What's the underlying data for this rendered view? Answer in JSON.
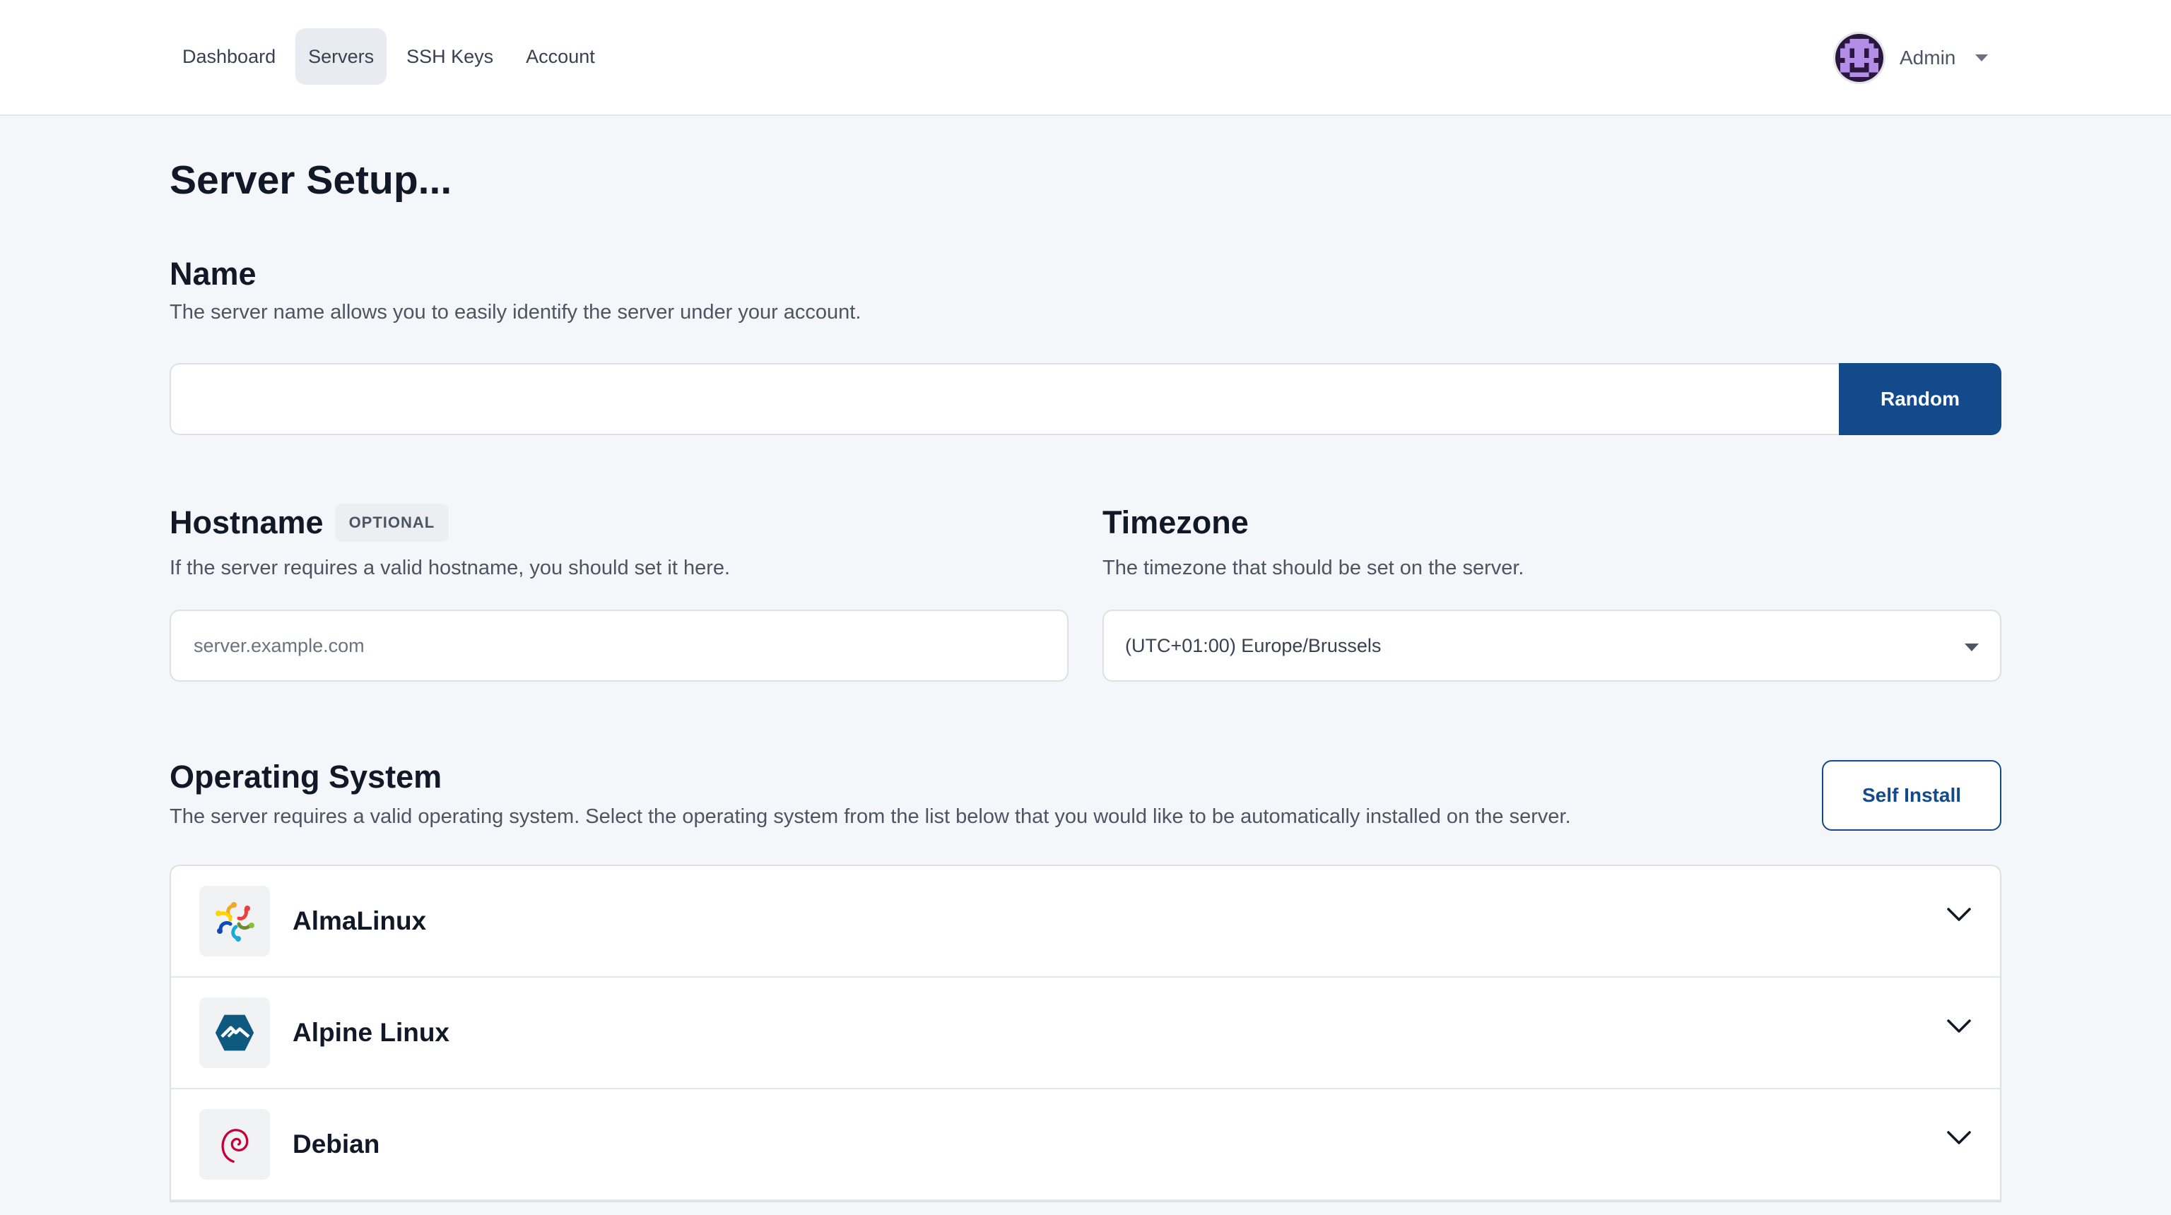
{
  "nav": {
    "items": [
      {
        "label": "Dashboard",
        "active": false
      },
      {
        "label": "Servers",
        "active": true
      },
      {
        "label": "SSH Keys",
        "active": false
      },
      {
        "label": "Account",
        "active": false
      }
    ],
    "user": {
      "name": "Admin",
      "avatar_icon": "pixel-avatar-icon"
    }
  },
  "page": {
    "title": "Server Setup..."
  },
  "name_section": {
    "title": "Name",
    "description": "The server name allows you to easily identify the server under your account.",
    "value": "",
    "random_label": "Random"
  },
  "hostname_section": {
    "title": "Hostname",
    "badge": "OPTIONAL",
    "description": "If the server requires a valid hostname, you should set it here.",
    "value": "",
    "placeholder": "server.example.com"
  },
  "timezone_section": {
    "title": "Timezone",
    "description": "The timezone that should be set on the server.",
    "selected": "(UTC+01:00) Europe/Brussels"
  },
  "os_section": {
    "title": "Operating System",
    "description": "The server requires a valid operating system. Select the operating system from the list below that you would like to be automatically installed on the server.",
    "self_install_label": "Self Install",
    "items": [
      {
        "name": "AlmaLinux",
        "icon": "almalinux-icon"
      },
      {
        "name": "Alpine Linux",
        "icon": "alpine-icon"
      },
      {
        "name": "Debian",
        "icon": "debian-icon"
      }
    ]
  },
  "colors": {
    "primary": "#134a8c",
    "background": "#f5f6f9",
    "avatar": "#7c3aed"
  }
}
